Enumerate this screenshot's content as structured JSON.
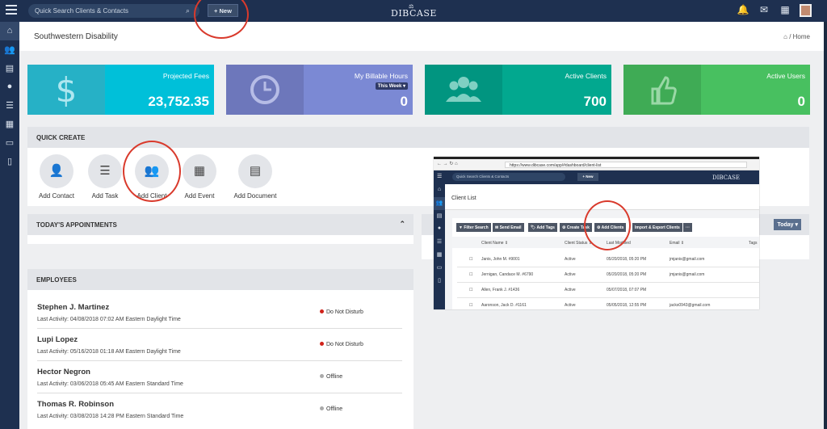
{
  "topbar": {
    "search_placeholder": "Quick Search Clients & Contacts",
    "new_label": "+ New",
    "logo": "DIBCASE"
  },
  "page": {
    "title": "Southwestern Disability",
    "breadcrumb": "Home"
  },
  "stats": [
    {
      "label": "Projected Fees",
      "value": "23,752.35",
      "icon": "dollar-icon",
      "color": "#00c0d9",
      "icon_bg": "#26b1c6"
    },
    {
      "label": "My Billable Hours",
      "value": "0",
      "chip": "This Week ▾",
      "icon": "clock-icon",
      "color": "#7b89d4",
      "icon_bg": "#6d77bb"
    },
    {
      "label": "Active Clients",
      "value": "700",
      "icon": "users-icon",
      "color": "#02a88f",
      "icon_bg": "#019580"
    },
    {
      "label": "Active Users",
      "value": "0",
      "icon": "thumbs-up-icon",
      "color": "#48c060",
      "icon_bg": "#3fab55"
    }
  ],
  "quick_create": {
    "title": "QUICK CREATE",
    "items": [
      {
        "label": "Add Contact",
        "icon": "add-contact-icon"
      },
      {
        "label": "Add Task",
        "icon": "task-icon"
      },
      {
        "label": "Add Client",
        "icon": "users-icon"
      },
      {
        "label": "Add Event",
        "icon": "calendar-icon"
      },
      {
        "label": "Add Document",
        "icon": "document-icon"
      }
    ]
  },
  "appointments": {
    "title": "TODAY'S APPOINTMENTS",
    "filter": "Today ▾"
  },
  "employees": {
    "title": "EMPLOYEES",
    "rows": [
      {
        "name": "Stephen J. Martinez",
        "activity": "Last Activity: 04/08/2018 07:02 AM Eastern Daylight Time",
        "status": "Do Not Disturb",
        "color": "#d0221a"
      },
      {
        "name": "Lupi Lopez",
        "activity": "Last Activity: 05/16/2018 01:18 AM Eastern Daylight Time",
        "status": "Do Not Disturb",
        "color": "#d0221a"
      },
      {
        "name": "Hector Negron",
        "activity": "Last Activity: 03/06/2018 05:45 AM Eastern Standard Time",
        "status": "Offline",
        "color": "#aaaaaa"
      },
      {
        "name": "Thomas R. Robinson",
        "activity": "Last Activity: 03/08/2018 14:28 PM Eastern Standard Time",
        "status": "Offline",
        "color": "#aaaaaa"
      }
    ]
  },
  "inset": {
    "url": "https://www.dibcase.com/app/#dashboard/client-list",
    "search_placeholder": "Quick Search Clients & Contacts",
    "new_label": "+ New",
    "logo": "DIBCASE",
    "title": "Client List",
    "toolbar": [
      "▼ Filter Search",
      "✉ Send Email",
      "🏷 Add Tags",
      "⚙ Create Task",
      "⚙ Add Clients",
      "Import & Export Clients",
      "···"
    ],
    "headers": [
      "Client Name ⇕",
      "Client Status ⇕",
      "Last Modified",
      "Email ⇕",
      "Tags"
    ],
    "rows": [
      [
        "Janis, John M. #9001",
        "Active",
        "05/20/2018, 05:20 PM",
        "jmjanis@gmail.com"
      ],
      [
        "Jernigan, Candace M. #6790",
        "Active",
        "05/20/2018, 05:20 PM",
        "jmjanis@gmail.com"
      ],
      [
        "Allen, Frank J. #1436",
        "Active",
        "05/07/2018, 07:07 PM",
        ""
      ],
      [
        "Aaronson, Jack D. #1161",
        "Active",
        "05/05/2018, 12:55 PM",
        "jacks0943@gmail.com"
      ]
    ]
  }
}
